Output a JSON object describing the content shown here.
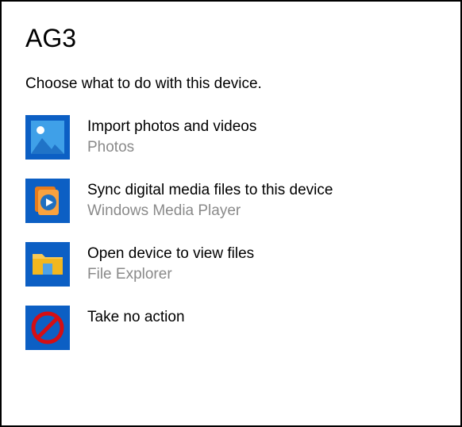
{
  "title": "AG3",
  "subtitle": "Choose what to do with this device.",
  "options": [
    {
      "title": "Import photos and videos",
      "subtitle": "Photos",
      "icon": "photos-icon"
    },
    {
      "title": "Sync digital media files to this device",
      "subtitle": "Windows Media Player",
      "icon": "media-player-icon"
    },
    {
      "title": "Open device to view files",
      "subtitle": "File Explorer",
      "icon": "file-explorer-icon"
    },
    {
      "title": "Take no action",
      "subtitle": "",
      "icon": "no-action-icon"
    }
  ]
}
